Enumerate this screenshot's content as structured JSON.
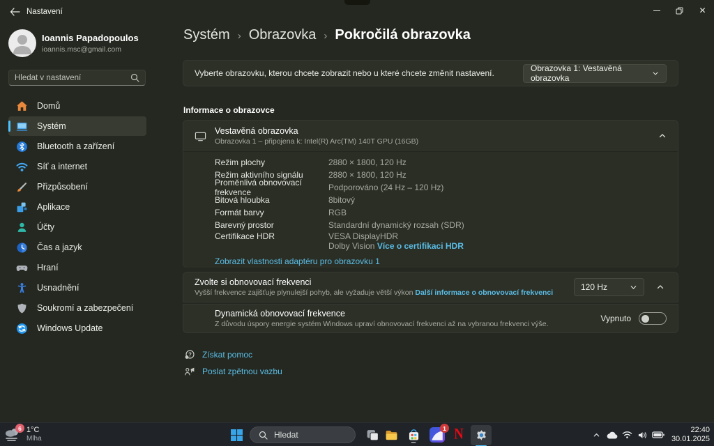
{
  "colors": {
    "accent": "#4cc2ff",
    "link": "#5bbde6",
    "netflix_red": "#e50914",
    "badge_red": "#d23b3b"
  },
  "titlebar": {
    "app_title": "Nastavení"
  },
  "user": {
    "name": "Ioannis Papadopoulos",
    "email": "ioannis.msc@gmail.com"
  },
  "search": {
    "placeholder": "Hledat v nastavení"
  },
  "sidebar": {
    "items": [
      {
        "label": "Domů",
        "icon": "home"
      },
      {
        "label": "Systém",
        "icon": "system",
        "selected": true
      },
      {
        "label": "Bluetooth a zařízení",
        "icon": "bluetooth"
      },
      {
        "label": "Síť a internet",
        "icon": "network"
      },
      {
        "label": "Přizpůsobení",
        "icon": "personalization"
      },
      {
        "label": "Aplikace",
        "icon": "apps"
      },
      {
        "label": "Účty",
        "icon": "accounts"
      },
      {
        "label": "Čas a jazyk",
        "icon": "time-language"
      },
      {
        "label": "Hraní",
        "icon": "gaming"
      },
      {
        "label": "Usnadnění",
        "icon": "accessibility"
      },
      {
        "label": "Soukromí a zabezpečení",
        "icon": "privacy"
      },
      {
        "label": "Windows Update",
        "icon": "windows-update"
      }
    ]
  },
  "breadcrumb": {
    "part1": "Systém",
    "sep": "›",
    "part2": "Obrazovka",
    "current": "Pokročilá obrazovka"
  },
  "select_display_card": {
    "description": "Vyberte obrazovku, kterou chcete zobrazit nebo u které chcete změnit nastavení.",
    "dropdown_value": "Obrazovka 1: Vestavěná obrazovka"
  },
  "display_info": {
    "section_heading": "Informace o obrazovce",
    "title": "Vestavěná obrazovka",
    "subtitle": "Obrazovka 1 – připojena k: Intel(R) Arc(TM) 140T GPU (16GB)",
    "rows": [
      {
        "label": "Režim plochy",
        "value": "2880 × 1800, 120 Hz"
      },
      {
        "label": "Režim aktivního signálu",
        "value": "2880 × 1800, 120 Hz"
      },
      {
        "label": "Proměnlivá obnovovací frekvence",
        "value": "Podporováno (24 Hz – 120 Hz)"
      },
      {
        "label": "Bitová hloubka",
        "value": "8bitový"
      },
      {
        "label": "Formát barvy",
        "value": "RGB"
      },
      {
        "label": "Barevný prostor",
        "value": "Standardní dynamický rozsah (SDR)"
      }
    ],
    "hdr_row": {
      "label": "Certifikace HDR",
      "line1": "VESA DisplayHDR",
      "line2": "Dolby Vision",
      "link": "Více o certifikaci HDR"
    },
    "adapter_link": "Zobrazit vlastnosti adaptéru pro obrazovku 1"
  },
  "refresh_rate": {
    "title": "Zvolte si obnovovací frekvenci",
    "subtitle": "Vyšší frekvence zajišťuje plynulejší pohyb, ale vyžaduje větší výkon",
    "link": "Další informace o obnovovací frekvenci",
    "dropdown_value": "120 Hz"
  },
  "dynamic_refresh": {
    "title": "Dynamická obnovovací frekvence",
    "subtitle": "Z důvodu úspory energie systém Windows upraví obnovovací frekvenci až na vybranou frekvenci výše.",
    "toggle_label": "Vypnuto",
    "toggle_state": "off"
  },
  "footer": {
    "help": "Získat pomoc",
    "feedback": "Poslat zpětnou vazbu"
  },
  "taskbar": {
    "weather": {
      "badge": "6",
      "temperature": "1°C",
      "condition": "Mlha"
    },
    "search_placeholder": "Hledat",
    "netflix_glyph": "N",
    "notification_badge": "1",
    "clock": {
      "time": "22:40",
      "date": "30.01.2025"
    }
  }
}
